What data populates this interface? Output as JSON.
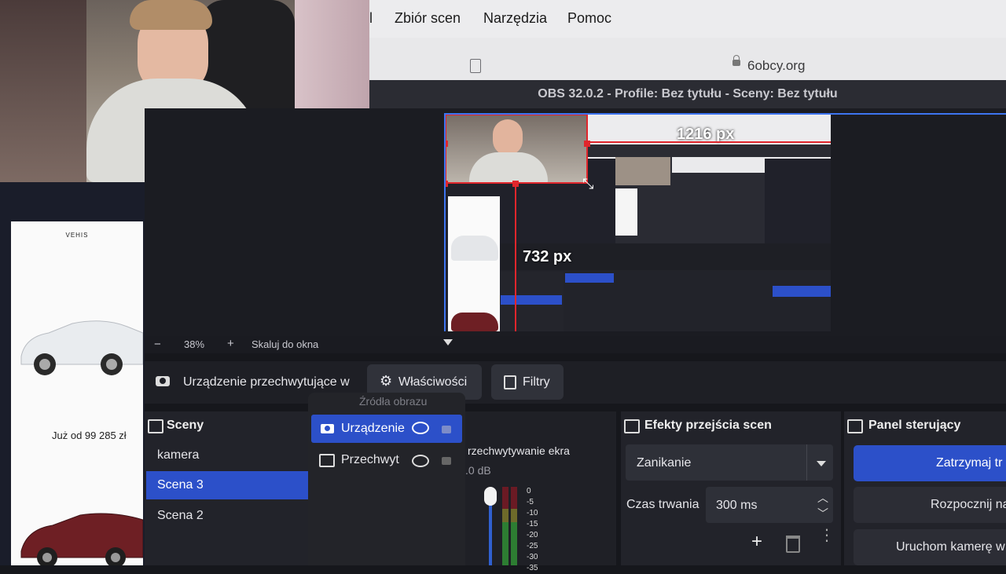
{
  "menubar": {
    "items": [
      "l",
      "Zbiór scen",
      "Narzędzia",
      "Pomoc"
    ]
  },
  "browser": {
    "url": "6obcy.org"
  },
  "obs": {
    "title": "OBS 32.0.2 - Profile: Bez tytułu - Sceny: Bez tytułu"
  },
  "preview": {
    "width_label": "1216 px",
    "height_label": "732 px",
    "zoom": "38%",
    "zoom_minus": "−",
    "zoom_plus": "+",
    "scale_mode": "Skaluj do okna"
  },
  "left_panel": {
    "brand": "VEHIS",
    "promo": "Już od 99 285 zł"
  },
  "source_toolbar": {
    "source_name": "Urządzenie przechwytujące w",
    "properties": "Właściwości",
    "filters": "Filtry"
  },
  "sources": {
    "header": "Źródła obrazu",
    "items": [
      {
        "label": "Urządzenie",
        "selected": true
      },
      {
        "label": "Przechwyt",
        "selected": false
      }
    ]
  },
  "scenes": {
    "header": "Sceny",
    "items": [
      {
        "label": "kamera",
        "selected": false
      },
      {
        "label": "Scena 3",
        "selected": true
      },
      {
        "label": "Scena 2",
        "selected": false
      }
    ]
  },
  "mixer": {
    "channel": "rzechwytywanie ekra",
    "level": ".0 dB",
    "scale": [
      "0",
      "-5",
      "-10",
      "-15",
      "-20",
      "-25",
      "-30",
      "-35"
    ]
  },
  "transitions": {
    "header": "Efekty przejścia scen",
    "type": "Zanikanie",
    "duration_label": "Czas trwania",
    "duration": "300 ms"
  },
  "controls": {
    "header": "Panel sterujący",
    "buttons": [
      "Zatrzymaj tr",
      "Rozpocznij na",
      "Uruchom kamerę w"
    ]
  },
  "colors": {
    "accent": "#2c50c9",
    "selection_red": "#e0262c",
    "bg": "#16171c"
  }
}
